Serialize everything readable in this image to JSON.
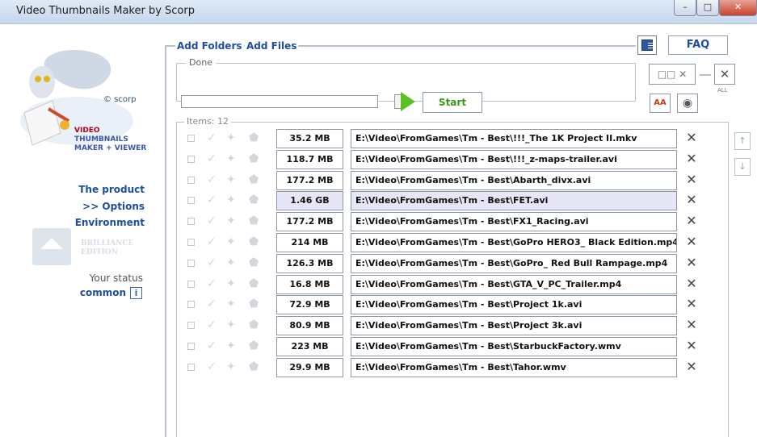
{
  "window": {
    "title": "Video Thumbnails Maker by Scorp",
    "min": "–",
    "max": "□",
    "close": "✕"
  },
  "sidebar": {
    "scorp": "© scorp",
    "brand": [
      "VIDEO",
      "THUMBNAILS",
      "MAKER + VIEWER"
    ],
    "nav": [
      "The product",
      ">> Options",
      "Environment"
    ],
    "brilliance": [
      "BRILLIANCE",
      "EDITION"
    ],
    "status_label": "Your status",
    "status_value": "common",
    "info": "i"
  },
  "toolbar": {
    "add_folders": "Add Folders",
    "add_files": "Add Files",
    "faq": "FAQ",
    "done": "Done",
    "start": "Start",
    "all": "ALL",
    "aa": "AA"
  },
  "items": {
    "label": "Items: 12",
    "rows": [
      {
        "size": "35.2 MB",
        "path": "E:\\Video\\FromGames\\Tm - Best\\!!!_The 1K Project II.mkv"
      },
      {
        "size": "118.7 MB",
        "path": "E:\\Video\\FromGames\\Tm - Best\\!!!_z-maps-trailer.avi"
      },
      {
        "size": "177.2 MB",
        "path": "E:\\Video\\FromGames\\Tm - Best\\Abarth_divx.avi"
      },
      {
        "size": "1.46 GB",
        "path": "E:\\Video\\FromGames\\Tm - Best\\FET.avi",
        "selected": true
      },
      {
        "size": "177.2 MB",
        "path": "E:\\Video\\FromGames\\Tm - Best\\FX1_Racing.avi"
      },
      {
        "size": "214 MB",
        "path": "E:\\Video\\FromGames\\Tm - Best\\GoPro HERO3_ Black Edition.mp4"
      },
      {
        "size": "126.3 MB",
        "path": "E:\\Video\\FromGames\\Tm - Best\\GoPro_ Red Bull Rampage.mp4"
      },
      {
        "size": "16.8 MB",
        "path": "E:\\Video\\FromGames\\Tm - Best\\GTA_V_PC_Trailer.mp4"
      },
      {
        "size": "72.9 MB",
        "path": "E:\\Video\\FromGames\\Tm - Best\\Project 1k.avi"
      },
      {
        "size": "80.9 MB",
        "path": "E:\\Video\\FromGames\\Tm - Best\\Project 3k.avi"
      },
      {
        "size": "223 MB",
        "path": "E:\\Video\\FromGames\\Tm - Best\\StarbuckFactory.wmv"
      },
      {
        "size": "29.9 MB",
        "path": "E:\\Video\\FromGames\\Tm - Best\\Tahor.wmv"
      }
    ]
  }
}
